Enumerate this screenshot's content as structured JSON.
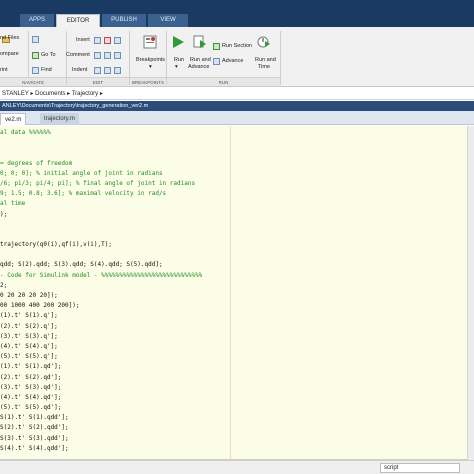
{
  "tabs": [
    "APPS",
    "EDITOR",
    "PUBLISH",
    "VIEW"
  ],
  "ribbon": {
    "file": [
      "nd Files",
      "ompare",
      "rint"
    ],
    "navigate": [
      "Go To",
      "Find"
    ],
    "navigate_group": "NAVIGATE",
    "edit": [
      "Insert",
      "Comment",
      "Indent"
    ],
    "edit_group": "EDIT",
    "breakpoints": "Breakpoints",
    "breakpoints_group": "BREAKPOINTS",
    "run": "Run",
    "run_advance": [
      "Run and",
      "Advance"
    ],
    "run_section": "Run Section",
    "advance": "Advance",
    "run_time": [
      "Run and",
      "Time"
    ],
    "run_group": "RUN"
  },
  "address": "STANLEY ▸ Documents ▸ Trajectory ▸",
  "window_title": "ANLEY\\Documents\\Trajectory\\trajectory_generation_ver2.m",
  "doc_tabs": [
    "ve2.m",
    "trajectory.m"
  ],
  "code_lines": [
    {
      "t": "al data %%%%%%",
      "c": true
    },
    {
      "t": "",
      "c": false
    },
    {
      "t": "",
      "c": false
    },
    {
      "t": "= degrees of freedom",
      "c": true
    },
    {
      "t": "0; 0; 0]; % initial angle of joint in radians",
      "c": true
    },
    {
      "t": "/6; pi/3; pi/4; pi]; % final angle of joint in radians",
      "c": true
    },
    {
      "t": "9; 1.5; 0.8; 3.6]; % maximal velocity in rad/s",
      "c": true
    },
    {
      "t": "al time",
      "c": true
    },
    {
      "t": ");",
      "c": false
    },
    {
      "t": "",
      "c": false
    },
    {
      "t": "",
      "c": false
    },
    {
      "t": "trajectory(q0(i),qf(i),v(i),T);",
      "c": false
    },
    {
      "t": "",
      "c": false
    },
    {
      "t": "qdd; S(2).qdd; S(3).qdd; S(4).qdd; S(5).qdd];",
      "c": false
    },
    {
      "t": "- Code for Simulink model - %%%%%%%%%%%%%%%%%%%%%%%%%%%%",
      "c": true
    },
    {
      "t": "2;",
      "c": false
    },
    {
      "t": "0 20 20 20 20]);",
      "c": false
    },
    {
      "t": "00 1000 400 200 200]);",
      "c": false
    },
    {
      "t": "(1).t' S(1).q'];",
      "c": false
    },
    {
      "t": "(2).t' S(2).q'];",
      "c": false
    },
    {
      "t": "(3).t' S(3).q'];",
      "c": false
    },
    {
      "t": "(4).t' S(4).q'];",
      "c": false
    },
    {
      "t": "(5).t' S(5).q'];",
      "c": false
    },
    {
      "t": "(1).t' S(1).qd'];",
      "c": false
    },
    {
      "t": "(2).t' S(2).qd'];",
      "c": false
    },
    {
      "t": "(3).t' S(3).qd'];",
      "c": false
    },
    {
      "t": "(4).t' S(4).qd'];",
      "c": false
    },
    {
      "t": "(5).t' S(5).qd'];",
      "c": false
    },
    {
      "t": "S(1).t' S(1).qdd'];",
      "c": false
    },
    {
      "t": "S(2).t' S(2).qdd'];",
      "c": false
    },
    {
      "t": "S(3).t' S(3).qdd'];",
      "c": false
    },
    {
      "t": "S(4).t' S(4).qdd'];",
      "c": false
    }
  ],
  "status": {
    "mode": "script"
  },
  "colors": {
    "tabbar": "#1b3a63",
    "editor_bg": "#fbfde6",
    "comment": "#228b22",
    "run_green": "#2f9b3a"
  }
}
